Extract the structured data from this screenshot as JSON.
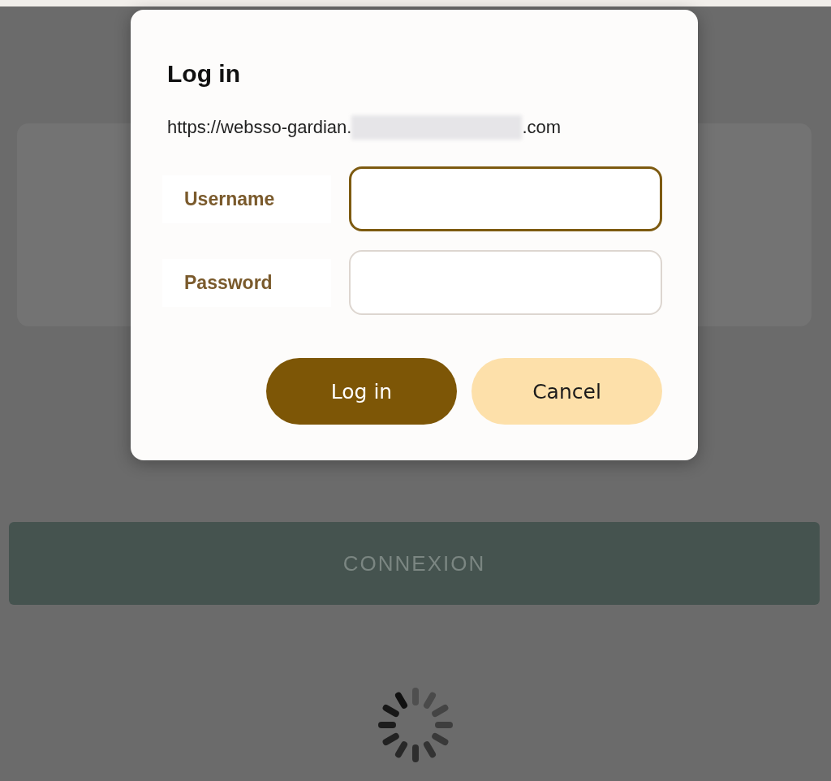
{
  "page": {
    "button": "CONNEXION",
    "loading": true
  },
  "dialog": {
    "title": "Log in",
    "url": {
      "prefix": "https://websso-gardian.",
      "suffix": ".com",
      "redacted": true
    },
    "fields": [
      {
        "label": "Username",
        "focused": true
      },
      {
        "label": "Password",
        "focused": false
      }
    ],
    "buttons": [
      {
        "label": "Log in",
        "kind": "primary"
      },
      {
        "label": "Cancel",
        "kind": "secondary"
      }
    ]
  }
}
